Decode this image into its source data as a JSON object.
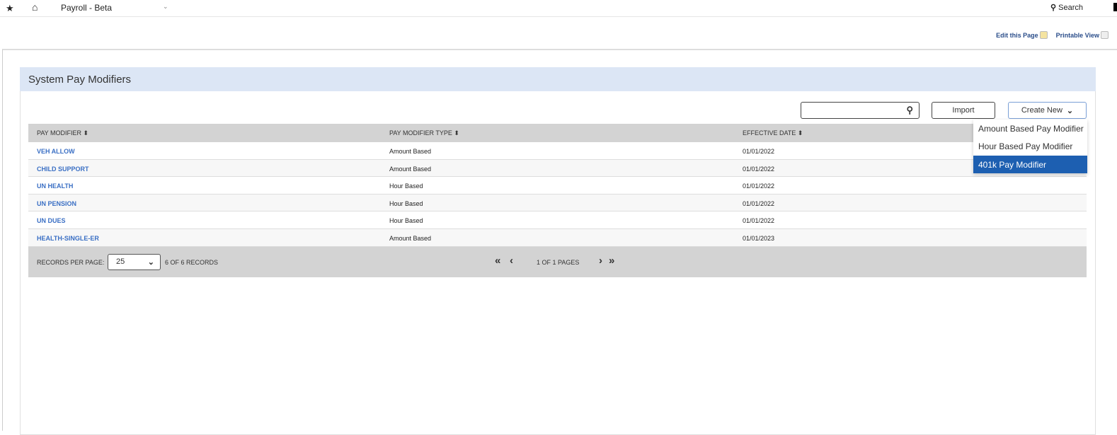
{
  "topbar": {
    "app_title": "Payroll - Beta",
    "search_label": "Search"
  },
  "page_links": {
    "edit": "Edit this Page",
    "print": "Printable View"
  },
  "panel": {
    "title": "System Pay Modifiers"
  },
  "toolbar": {
    "search_placeholder": "",
    "import_label": "Import",
    "create_label": "Create New"
  },
  "create_menu": [
    "Amount Based Pay Modifier",
    "Hour Based Pay Modifier",
    "401k Pay Modifier"
  ],
  "create_menu_selected": "401k Pay Modifier",
  "table": {
    "headers": [
      "PAY MODIFIER",
      "PAY MODIFIER TYPE",
      "EFFECTIVE DATE"
    ],
    "rows": [
      [
        "VEH ALLOW",
        "Amount Based",
        "01/01/2022"
      ],
      [
        "CHILD SUPPORT",
        "Amount Based",
        "01/01/2022"
      ],
      [
        "UN HEALTH",
        "Hour Based",
        "01/01/2022"
      ],
      [
        "UN PENSION",
        "Hour Based",
        "01/01/2022"
      ],
      [
        "UN DUES",
        "Hour Based",
        "01/01/2022"
      ],
      [
        "HEALTH-SINGLE-ER",
        "Amount Based",
        "01/01/2023"
      ]
    ]
  },
  "footer": {
    "rpp_label": "RECORDS PER PAGE:",
    "rpp_value": "25",
    "records": "6 OF 6 RECORDS",
    "pages": "1 OF 1 PAGES"
  }
}
